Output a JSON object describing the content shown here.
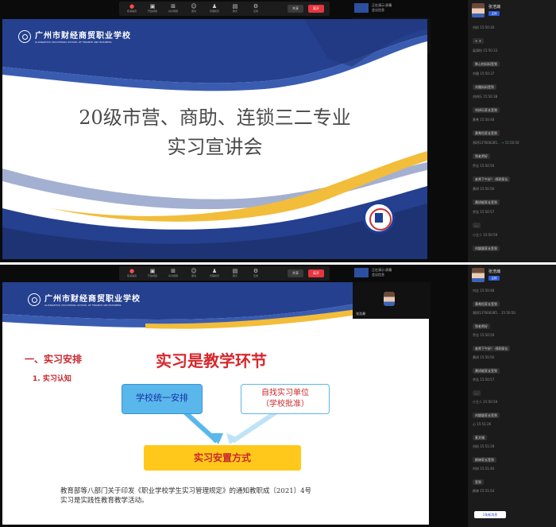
{
  "toolbar": {
    "items": [
      {
        "glyph": "●",
        "label": "取消静音"
      },
      {
        "glyph": "▣",
        "label": "开启视频"
      },
      {
        "glyph": "⊞",
        "label": "共享屏幕"
      },
      {
        "glyph": "☺",
        "label": "邀请"
      },
      {
        "glyph": "♟",
        "label": "管理成员"
      },
      {
        "glyph": "▤",
        "label": "聊天"
      },
      {
        "glyph": "⚙",
        "label": "应用"
      }
    ],
    "share_label": "共享",
    "end_label": "离开"
  },
  "mini_info": {
    "line1": "正在演示·屏幕",
    "line2": "会议信息"
  },
  "self_view": {
    "name": "张浩瀚"
  },
  "slide_top": {
    "logo_cn": "广州市财经商贸职业学校",
    "logo_en": "GUANGZHOU VOCATIONAL SCHOOL OF FINANCE AND BUSINESS",
    "title_line1": "20级市营、商助、连锁三二专业",
    "title_line2": "实习宣讲会"
  },
  "slide_bottom": {
    "logo_cn": "广州市财经商贸职业学校",
    "logo_en": "GUANGZHOU VOCATIONAL SCHOOL OF FINANCE AND BUSINESS",
    "section_heading": "一、实习安排",
    "sub_heading": "1. 实习认知",
    "main_topic": "实习是教学环节",
    "box_school": "学校统一安排",
    "box_self_line1": "自找实习单位",
    "box_self_line2": "（学校批准）",
    "box_result": "实习安置方式",
    "policy_line1": "教育部等八部门关于印发《职业学校学生实习管理规定》的通知教职成〔2021〕4号",
    "policy_line2": "实习是实践性教育教学活动。"
  },
  "chat_top": {
    "host_name": "张浩瀚",
    "host_badge": "主持",
    "messages": [
      {
        "sender": "刘妈",
        "time": "15:50:30",
        "text": "+  +"
      },
      {
        "sender": "梁清怡",
        "time": "15:50:33",
        "text": "陈心怡妈妈签到"
      },
      {
        "sender": "刘雅",
        "time": "15:50:37",
        "text": "刘雅妈妈签到"
      },
      {
        "sender": "刘妍乐",
        "time": "15:50:38",
        "text": "刘妍乐家长签到"
      },
      {
        "sender": "黄希",
        "time": "15:50:48",
        "text": "黄希恒家长签到"
      },
      {
        "sender": "郑玥137606285...",
        "time": "15:50:50",
        "text": "到老师好"
      },
      {
        "sender": "乔志",
        "time": "15:50:50",
        "text": "老师下午好！-郑玥家长"
      },
      {
        "sender": "黄妍",
        "time": "15:50:56",
        "text": "黄妍妮家长签到"
      },
      {
        "sender": "余泓",
        "time": "15:50:57",
        "text": "..."
      },
      {
        "sender": "小主人",
        "time": "15:50:59",
        "text": "刘颖颖家长签到"
      }
    ]
  },
  "chat_bottom": {
    "host_name": "张浩瀚",
    "host_badge": "主持",
    "messages": [
      {
        "sender": "刘志",
        "time": "15:50:48",
        "text": "黄希恒家长签到"
      },
      {
        "sender": "郑玥137606285...",
        "time": "15:50:50",
        "text": "到老师好"
      },
      {
        "sender": "乔志",
        "time": "15:50:50",
        "text": "老师下午好！-郑玥家长"
      },
      {
        "sender": "黄妍",
        "time": "15:50:56",
        "text": "黄妍妮家长签到"
      },
      {
        "sender": "余泓",
        "time": "15:50:57",
        "text": "..."
      },
      {
        "sender": "小主人",
        "time": "15:50:59",
        "text": "刘颖颖家长签到"
      },
      {
        "sender": "心",
        "time": "15:51:26",
        "text": "麦文锡"
      },
      {
        "sender": "刘妈",
        "time": "15:51:28",
        "text": "颜婷家长签到"
      },
      {
        "sender": "刘妍",
        "time": "15:51:46",
        "text": "签到"
      },
      {
        "sender": "颜婷",
        "time": "15:51:54",
        "text": ""
      }
    ],
    "new_messages_button": "1条新消息"
  },
  "colors": {
    "brand_blue": "#25408f",
    "gold": "#f2bd3a",
    "accent_red": "#c8282d"
  }
}
